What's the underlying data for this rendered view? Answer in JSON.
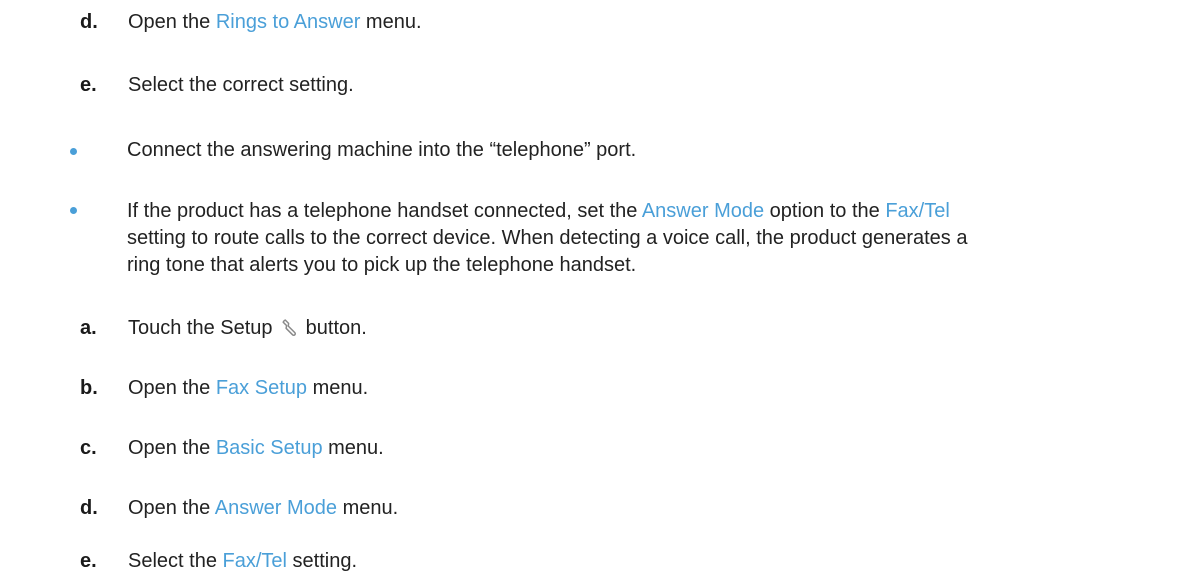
{
  "steps_top": [
    {
      "letter": "d.",
      "pre": "Open the ",
      "link": "Rings to Answer",
      "post": " menu."
    },
    {
      "letter": "e.",
      "text": "Select the correct setting."
    }
  ],
  "bullet1": {
    "text": "Connect the answering machine into the “telephone” port."
  },
  "bullet2": {
    "line1_pre": "If the product has a telephone handset connected, set the ",
    "line1_link1": "Answer Mode",
    "line1_mid": " option to the ",
    "line1_link2": "Fax/Tel",
    "line2": "setting to route calls to the correct device. When detecting a voice call, the product generates a",
    "line3": "ring tone that alerts you to pick up the telephone handset."
  },
  "steps_bottom": [
    {
      "letter": "a.",
      "pre": "Touch the Setup ",
      "icon": "wrench-icon",
      "post": " button."
    },
    {
      "letter": "b.",
      "pre": "Open the ",
      "link": "Fax Setup",
      "post": " menu."
    },
    {
      "letter": "c.",
      "pre": "Open the ",
      "link": "Basic Setup",
      "post": " menu."
    },
    {
      "letter": "d.",
      "pre": "Open the ",
      "link": "Answer Mode",
      "post": " menu."
    },
    {
      "letter": "e.",
      "pre": "Select the ",
      "link": "Fax/Tel",
      "post": " setting."
    }
  ],
  "colors": {
    "link": "#4a9fd8",
    "bullet": "#4a9fd8",
    "text": "#222222"
  }
}
